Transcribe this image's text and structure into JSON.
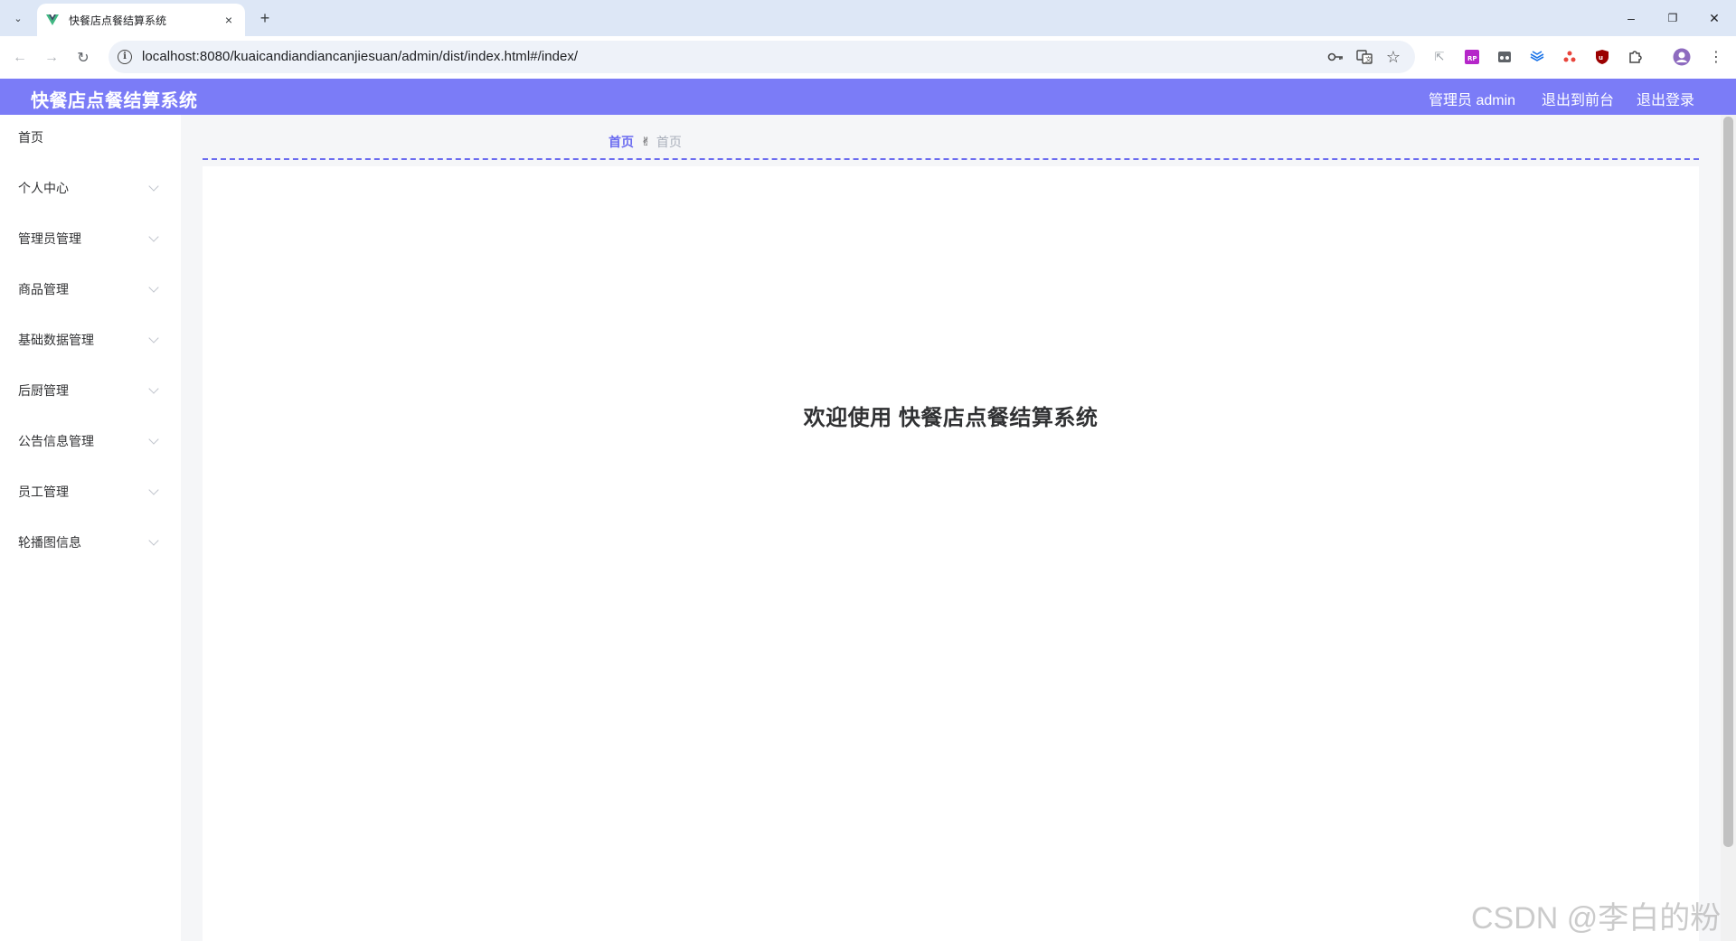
{
  "browser": {
    "tab_title": "快餐店点餐结算系统",
    "tab_close": "×",
    "new_tab": "+",
    "tab_menu": "⌄",
    "url": "localhost:8080/kuaicandiandiancanjiesuan/admin/dist/index.html#/index/",
    "window_controls": {
      "minimize": "–",
      "restore": "❐",
      "close": "✕"
    },
    "nav": {
      "back": "←",
      "forward": "→",
      "reload": "↻"
    }
  },
  "header": {
    "app_title": "快餐店点餐结算系统",
    "user_label": "管理员 admin",
    "frontend_link": "退出到前台",
    "logout_link": "退出登录"
  },
  "sidebar": {
    "items": [
      {
        "label": "首页",
        "has_arrow": false
      },
      {
        "label": "个人中心",
        "has_arrow": true
      },
      {
        "label": "管理员管理",
        "has_arrow": true
      },
      {
        "label": "商品管理",
        "has_arrow": true
      },
      {
        "label": "基础数据管理",
        "has_arrow": true
      },
      {
        "label": "后厨管理",
        "has_arrow": true
      },
      {
        "label": "公告信息管理",
        "has_arrow": true
      },
      {
        "label": "员工管理",
        "has_arrow": true
      },
      {
        "label": "轮播图信息",
        "has_arrow": true
      }
    ]
  },
  "breadcrumb": {
    "home": "首页",
    "separator": "✌",
    "current": "首页"
  },
  "main": {
    "welcome": "欢迎使用 快餐店点餐结算系统"
  },
  "watermark": "CSDN @李白的粉",
  "colors": {
    "accent": "#7b7cf7",
    "link": "#6b6cf0",
    "browser_chrome": "#dde7f6"
  },
  "icons": {
    "toolbar_right": [
      "key-icon",
      "translate-icon",
      "star-icon"
    ],
    "extensions": [
      "cursor-extension-icon",
      "rp-extension-icon",
      "incognito-extension-icon",
      "stack-extension-icon",
      "people-extension-icon",
      "ublock-extension-icon",
      "puzzle-extension-icon",
      "profile-avatar-icon",
      "kebab-menu-icon"
    ]
  }
}
